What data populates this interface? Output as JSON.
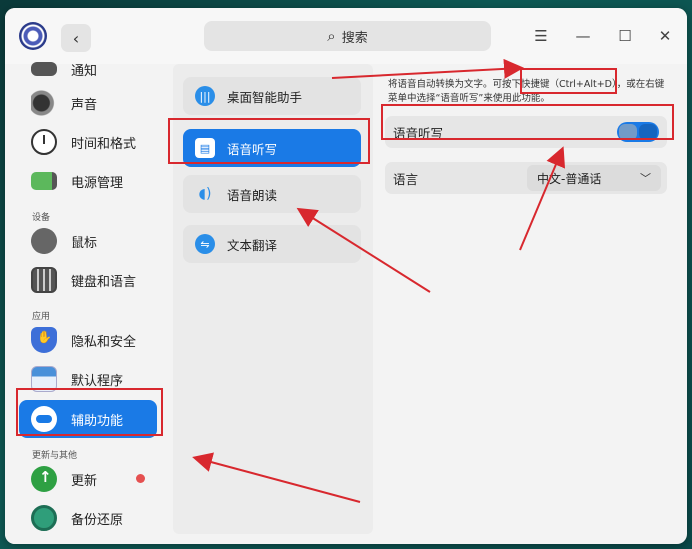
{
  "search": {
    "label": "搜索"
  },
  "sidebar": {
    "items": [
      {
        "label": "通知",
        "icon": "bell-icon"
      },
      {
        "label": "声音",
        "icon": "speaker-icon"
      },
      {
        "label": "时间和格式",
        "icon": "clock-icon"
      },
      {
        "label": "电源管理",
        "icon": "battery-icon"
      },
      {
        "label": "鼠标",
        "icon": "mouse-icon"
      },
      {
        "label": "键盘和语言",
        "icon": "keyboard-icon"
      },
      {
        "label": "隐私和安全",
        "icon": "shield-hand-icon"
      },
      {
        "label": "默认程序",
        "icon": "default-apps-icon"
      },
      {
        "label": "辅助功能",
        "icon": "accessibility-icon",
        "active": true
      },
      {
        "label": "更新",
        "icon": "update-arrow-icon"
      },
      {
        "label": "备份还原",
        "icon": "backup-icon"
      }
    ],
    "groups": {
      "device": "设备",
      "apps": "应用",
      "update_other": "更新与其他"
    }
  },
  "middle": {
    "items": [
      {
        "label": "桌面智能助手",
        "icon": "voice-wave-icon"
      },
      {
        "label": "语音听写",
        "icon": "dictation-icon",
        "active": true
      },
      {
        "label": "语音朗读",
        "icon": "speaker-wave-icon"
      },
      {
        "label": "文本翻译",
        "icon": "translate-icon"
      }
    ]
  },
  "content": {
    "description_line1": "将语音自动转换为文字。可按下快捷键（Ctrl+Alt+D），或在右键",
    "description_line2": "菜单中选择“语音听写”来使用此功能。",
    "dictation_toggle": {
      "label": "语音听写",
      "enabled": true
    },
    "language": {
      "label": "语言",
      "value": "中文-普通话"
    }
  },
  "colors": {
    "accent": "#1a7ae6",
    "annotation": "#d8282e"
  }
}
